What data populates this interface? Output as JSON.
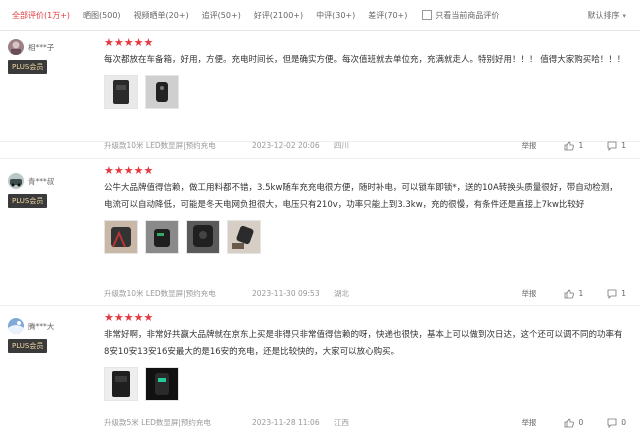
{
  "tabs": [
    {
      "label": "全部评价(1万+)",
      "active": true
    },
    {
      "label": "晒图(500)"
    },
    {
      "label": "视频晒单(20+)"
    },
    {
      "label": "追评(50+)"
    },
    {
      "label": "好评(2100+)"
    },
    {
      "label": "中评(30+)"
    },
    {
      "label": "差评(70+)"
    }
  ],
  "only_current_label": "只看当前商品评价",
  "sort_label": "默认排序",
  "reviews": [
    {
      "username": "相***子",
      "badge": "PLUS会员",
      "text": "每次都放在车备箱，好用，方便。充电时间长，但是确实方便。每次值班就去单位充，充满就走人。特别好用！！！ 值得大家购买哈！！！",
      "spec": "升级款10米 LED数显屏|预约充电",
      "time": "2023-12-02 20:06",
      "location": "四川",
      "report": "举报",
      "likes": "1",
      "comments": "1"
    },
    {
      "username": "青***叔",
      "badge": "PLUS会员",
      "text": "公牛大品牌值得信赖，做工用料都不错，3.5kw随车充充电很方便，随时补电，可以锁车即锁*，送的10A转换头质量很好，带自动检测，电流可以自动降低，可能是冬天电网负担很大，电压只有210v，功率只能上到3.3kw，充的很慢，有条件还是直接上7kw比较好",
      "spec": "升级款10米 LED数显屏|预约充电",
      "time": "2023-11-30 09:53",
      "location": "湖北",
      "report": "举报",
      "likes": "1",
      "comments": "1"
    },
    {
      "username": "腾***大",
      "badge": "PLUS会员",
      "text": "非常好啊，非常好共赢大品牌就在京东上买是非得只非常值得信赖的呀，快递也很快，基本上可以做到次日达，这个还可以调不同的功率有8安10安13安16安最大的是16安的充电，还是比较快的，大家可以放心购买。",
      "spec": "升级款5米 LED数显屏|预约充电",
      "time": "2023-11-28 11:06",
      "location": "江西",
      "report": "举报",
      "likes": "0",
      "comments": "0"
    }
  ]
}
